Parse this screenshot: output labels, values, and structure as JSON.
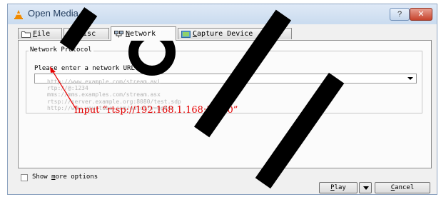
{
  "window": {
    "title": "Open Media",
    "help_label": "?",
    "close_label": "✕"
  },
  "tabs": [
    {
      "label_prefix": "",
      "mnemonic": "F",
      "label_rest": "ile",
      "icon": "folder-icon"
    },
    {
      "label_prefix": "",
      "mnemonic": "D",
      "label_rest": "isc",
      "icon": "disc-icon"
    },
    {
      "label_prefix": "",
      "mnemonic": "N",
      "label_rest": "etwork",
      "icon": "network-icon"
    },
    {
      "label_prefix": "",
      "mnemonic": "C",
      "label_rest": "apture Device",
      "icon": "capture-device-icon"
    }
  ],
  "network": {
    "group_title": "Network Protocol",
    "prompt": "Please enter a network URL:",
    "url_value": "",
    "examples": [
      "http://www.example.com/stream.avi",
      "rtp://@:1234",
      "mms://mms.examples.com/stream.asx",
      "rtsp://server.example.org:8080/test.sdp",
      "http://www.yourtube.com/watch?v=gg64x"
    ]
  },
  "annotation": "Input “rtsp://192.168.1.168:554/0”",
  "options": {
    "show_more_prefix": "Show ",
    "show_more_mnemonic": "m",
    "show_more_rest": "ore options"
  },
  "buttons": {
    "play_mnemonic": "P",
    "play_rest": "lay",
    "cancel_mnemonic": "C",
    "cancel_rest": "ancel"
  },
  "colors": {
    "annotation": "#e60000",
    "accent": "#1e395b"
  }
}
